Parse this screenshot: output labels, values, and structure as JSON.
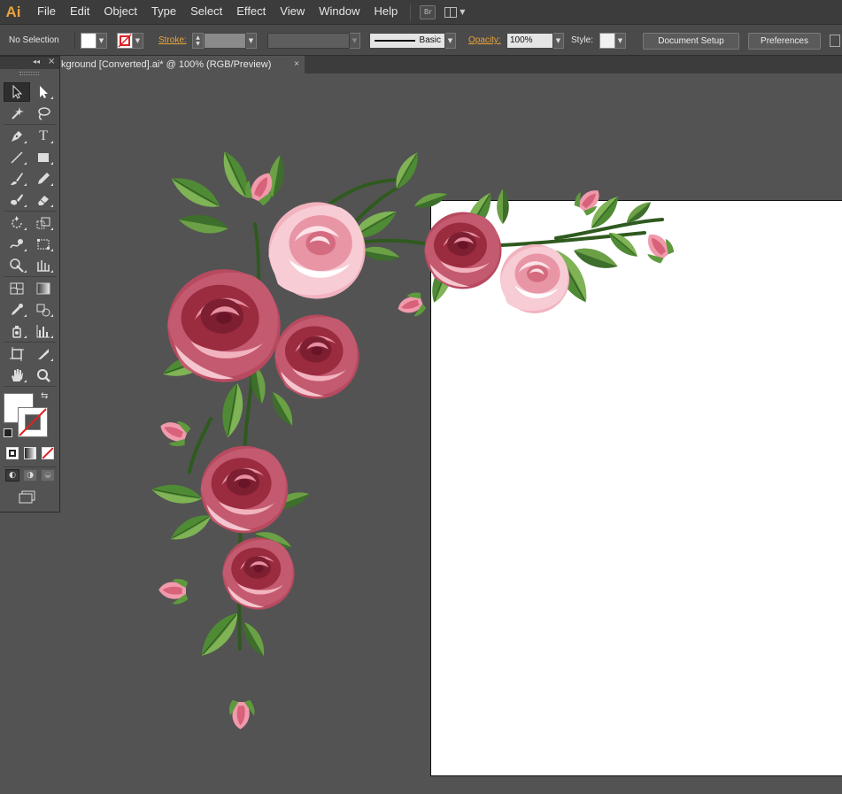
{
  "app": {
    "logo": "Ai",
    "menu": [
      "File",
      "Edit",
      "Object",
      "Type",
      "Select",
      "Effect",
      "View",
      "Window",
      "Help"
    ],
    "bridge_label": "Br"
  },
  "control_bar": {
    "selection_status": "No Selection",
    "stroke_label": "Stroke:",
    "stroke_profile": "Basic",
    "opacity_label": "Opacity:",
    "opacity_value": "100%",
    "style_label": "Style:",
    "document_setup_button": "Document Setup",
    "preferences_button": "Preferences"
  },
  "document_tab": {
    "title": "kground [Converted].ai* @ 100% (RGB/Preview)",
    "close_glyph": "×"
  },
  "tools_panel": {
    "collapse_glyph": "◂◂",
    "close_glyph": "×",
    "tools": [
      [
        "selection-tool",
        "direct-selection-tool"
      ],
      [
        "magic-wand-tool",
        "lasso-tool"
      ],
      [
        "pen-tool",
        "type-tool"
      ],
      [
        "line-segment-tool",
        "rectangle-tool"
      ],
      [
        "paintbrush-tool",
        "pencil-tool"
      ],
      [
        "blob-brush-tool",
        "eraser-tool"
      ],
      [
        "rotate-tool",
        "scale-tool"
      ],
      [
        "warp-tool",
        "free-transform-tool"
      ],
      [
        "shape-builder-tool",
        "perspective-grid-tool"
      ],
      [
        "mesh-tool",
        "gradient-tool"
      ],
      [
        "eyedropper-tool",
        "blend-tool"
      ],
      [
        "symbol-sprayer-tool",
        "column-graph-tool"
      ],
      [
        "artboard-tool",
        "slice-tool"
      ],
      [
        "hand-tool",
        "zoom-tool"
      ]
    ],
    "type_glyph": "T"
  },
  "colors": {
    "accent_orange": "#e8a33a",
    "ui_dark": "#3c3c3c",
    "ui_mid": "#4a4a4a",
    "canvas": "#535353",
    "rose_dark": "#9b2b3f",
    "rose_mid": "#d46b7f",
    "rose_light": "#f2b3bf",
    "leaf_dark": "#3d6e2c",
    "leaf_light": "#7fb356"
  }
}
